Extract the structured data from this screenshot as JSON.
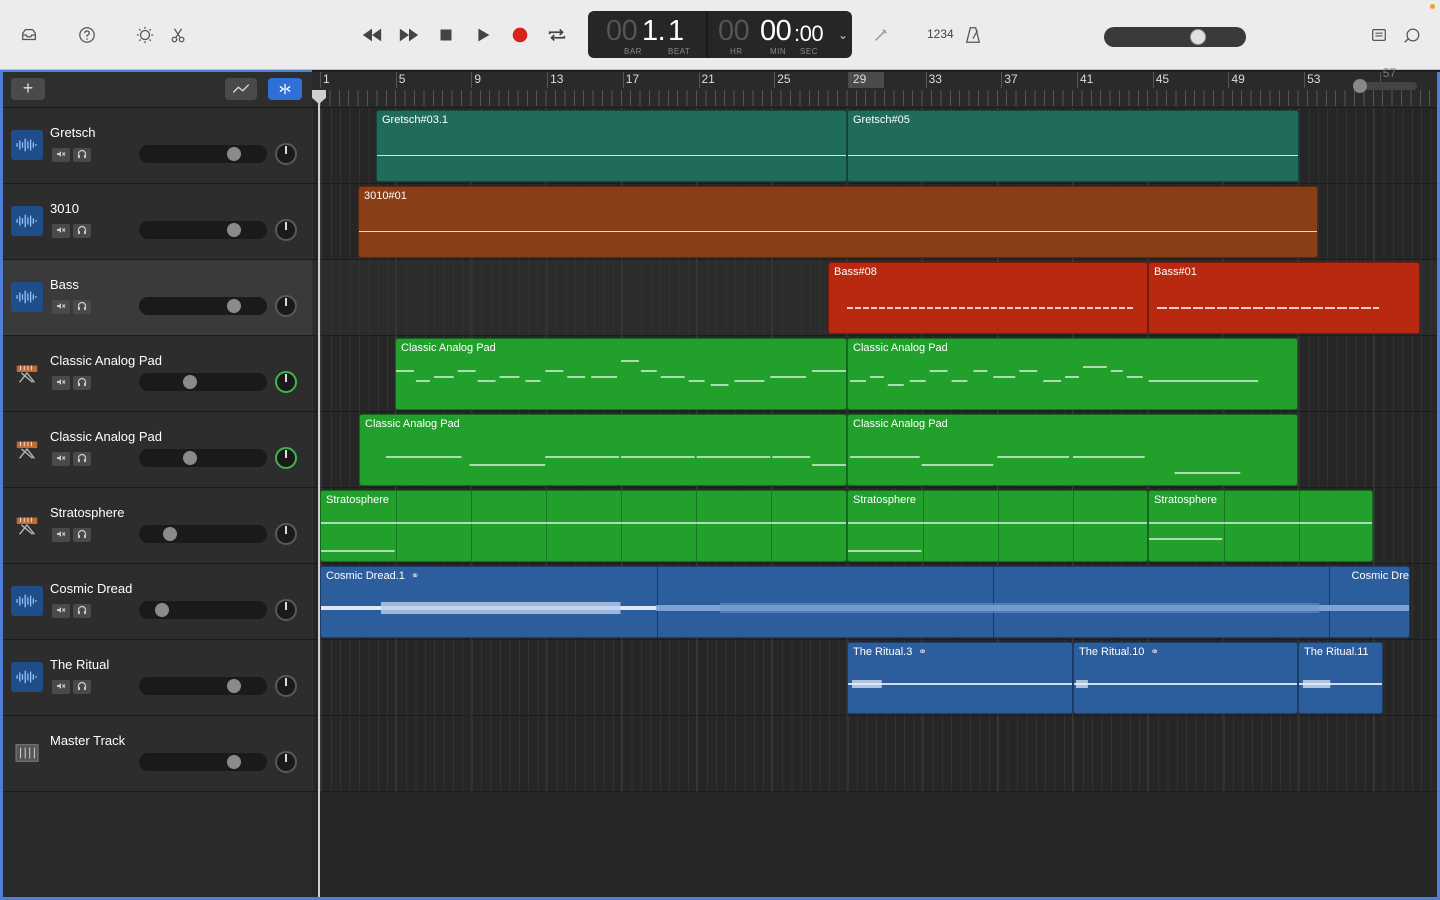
{
  "toolbar": {
    "lcd": {
      "bar_dim": "00",
      "bar": "1.",
      "beat": "1",
      "hr_dim": "00",
      "min": "00",
      "sec": ":00",
      "label_bar": "BAR",
      "label_beat": "BEAT",
      "label_hr": "HR",
      "label_min": "MIN",
      "label_sec": "SEC"
    },
    "count_in": "1234",
    "master_volume": 0.65
  },
  "header_bar": {
    "add_label": "+"
  },
  "ruler": {
    "bars": [
      "1",
      "5",
      "9",
      "13",
      "17",
      "21",
      "25",
      "29",
      "33",
      "37",
      "41",
      "45",
      "49",
      "53",
      "57"
    ]
  },
  "tracks": [
    {
      "name": "Gretsch",
      "type": "audio",
      "selected": false,
      "volume": 0.78,
      "icon": "waveform-icon"
    },
    {
      "name": "3010",
      "type": "audio",
      "selected": false,
      "volume": 0.78,
      "icon": "waveform-icon"
    },
    {
      "name": "Bass",
      "type": "audio",
      "selected": true,
      "volume": 0.78,
      "icon": "waveform-icon"
    },
    {
      "name": "Classic Analog Pad",
      "type": "software",
      "selected": false,
      "volume": 0.38,
      "icon": "keyboard-icon"
    },
    {
      "name": "Classic Analog Pad",
      "type": "software",
      "selected": false,
      "volume": 0.38,
      "icon": "keyboard-icon"
    },
    {
      "name": "Stratosphere",
      "type": "software",
      "selected": false,
      "volume": 0.2,
      "icon": "keyboard-icon"
    },
    {
      "name": "Cosmic Dread",
      "type": "audio",
      "selected": false,
      "volume": 0.13,
      "icon": "waveform-icon"
    },
    {
      "name": "The Ritual",
      "type": "audio",
      "selected": false,
      "volume": 0.78,
      "icon": "waveform-icon"
    },
    {
      "name": "Master Track",
      "type": "master",
      "selected": false,
      "volume": 0.78,
      "icon": "master-icon"
    }
  ],
  "regions": {
    "gretsch": [
      "Gretsch#03.1",
      "Gretsch#05"
    ],
    "r3010": [
      "3010#01"
    ],
    "bass": [
      "Bass#08",
      "Bass#01"
    ],
    "pad1": [
      "Classic Analog Pad",
      "Classic Analog Pad"
    ],
    "pad2": [
      "Classic Analog Pad",
      "Classic Analog Pad"
    ],
    "strat": [
      "Stratosphere",
      "Stratosphere",
      "Stratosphere"
    ],
    "cosmic": [
      "Cosmic Dread.1",
      "Cosmic Dre"
    ],
    "ritual": [
      "The Ritual.3",
      "The Ritual.10",
      "The Ritual.11"
    ]
  },
  "colors": {
    "accent": "#4f7fd6",
    "record": "#d9221c",
    "drums": "#1f6b5c",
    "synth": "#8a3e17",
    "bass": "#b8290f",
    "pads": "#21a12c",
    "audio": "#2c5e9e"
  }
}
